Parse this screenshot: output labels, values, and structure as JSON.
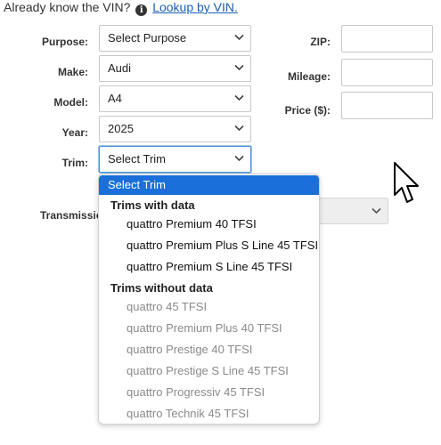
{
  "header": {
    "prefix": "Already know the VIN?",
    "info_icon": "i",
    "lookup_link": "Lookup by VIN."
  },
  "form": {
    "purpose": {
      "label": "Purpose:",
      "value": "Select Purpose"
    },
    "make": {
      "label": "Make:",
      "value": "Audi"
    },
    "model": {
      "label": "Model:",
      "value": "A4"
    },
    "year": {
      "label": "Year:",
      "value": "2025"
    },
    "trim": {
      "label": "Trim:",
      "value": "Select Trim"
    },
    "transmission": {
      "label": "Transmissio"
    },
    "zip": {
      "label": "ZIP:",
      "value": ""
    },
    "mileage": {
      "label": "Mileage:",
      "value": ""
    },
    "price": {
      "label": "Price ($):",
      "value": ""
    }
  },
  "trim_dropdown": {
    "selected": "Select Trim",
    "groups": [
      {
        "label": "Trims with data",
        "options": [
          "quattro Premium 40 TFSI",
          "quattro Premium Plus S Line 45 TFSI",
          "quattro Premium S Line 45 TFSI"
        ]
      },
      {
        "label": "Trims without data",
        "options": [
          "quattro 45 TFSI",
          "quattro Premium Plus 40 TFSI",
          "quattro Prestige 40 TFSI",
          "quattro Prestige S Line 45 TFSI",
          "quattro Progressiv 45 TFSI",
          "quattro Technik 45 TFSI"
        ]
      }
    ]
  },
  "colors": {
    "accent": "#1a6fd8",
    "link": "#1a5fb4",
    "disabled_text": "#8a8a8a"
  }
}
